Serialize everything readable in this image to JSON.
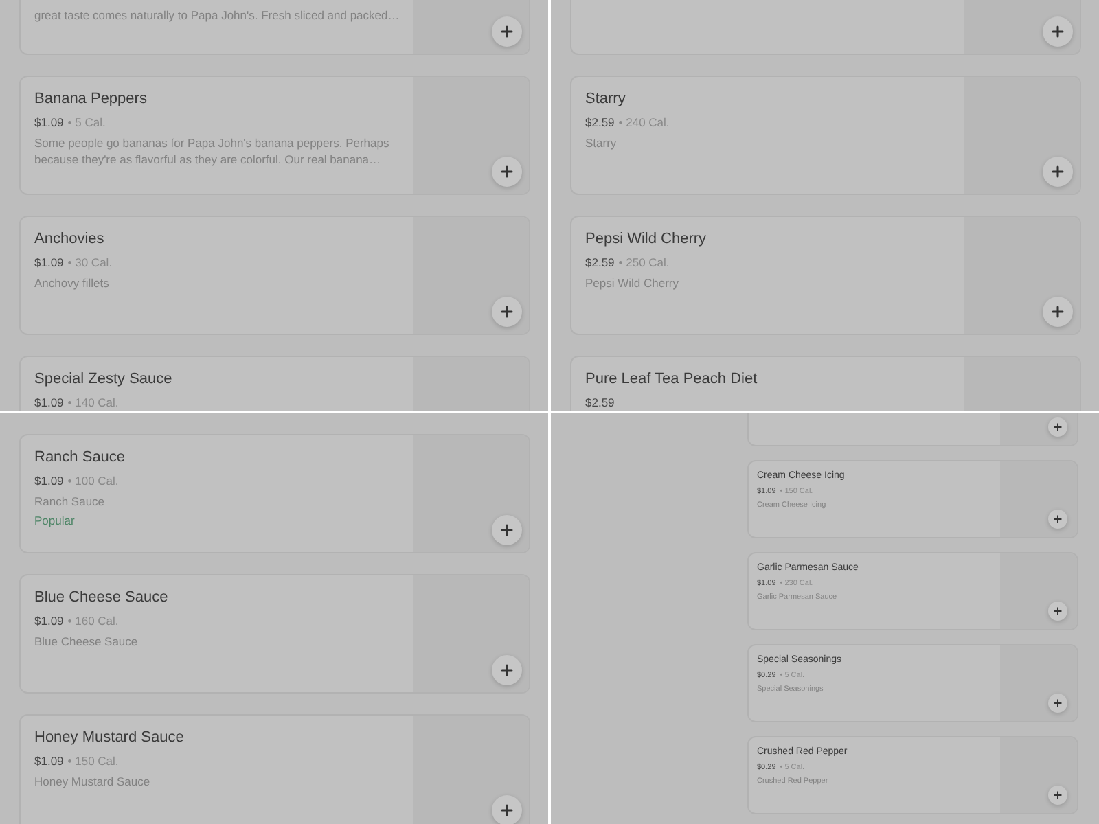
{
  "panels": [
    {
      "kind": "full",
      "items": [
        {
          "kind": "cut",
          "description": "great taste comes naturally to Papa John's. Fresh sliced and packed…"
        },
        {
          "kind": "item",
          "name": "Banana Peppers",
          "price": "$1.09",
          "calories": "• 5 Cal.",
          "description": "Some people go bananas for Papa John's banana peppers. Perhaps because they're as flavorful as they are colorful. Our real banana…"
        },
        {
          "kind": "item",
          "name": "Anchovies",
          "price": "$1.09",
          "calories": "• 30 Cal.",
          "description": "Anchovy fillets"
        },
        {
          "kind": "clipped",
          "name": "Special Zesty Sauce",
          "price": "$1.09",
          "calories": "• 140 Cal."
        }
      ]
    },
    {
      "kind": "full",
      "items": [
        {
          "kind": "cut"
        },
        {
          "kind": "item",
          "name": "Starry",
          "price": "$2.59",
          "calories": "• 240 Cal.",
          "description": "Starry"
        },
        {
          "kind": "item",
          "name": "Pepsi Wild Cherry",
          "price": "$2.59",
          "calories": "• 250 Cal.",
          "description": "Pepsi Wild Cherry"
        },
        {
          "kind": "clipped",
          "name": "Pure Leaf Tea Peach Diet",
          "price": "$2.59"
        }
      ]
    },
    {
      "kind": "full",
      "items": [
        {
          "kind": "item",
          "name": "Ranch Sauce",
          "price": "$1.09",
          "calories": "• 100 Cal.",
          "description": "Ranch Sauce",
          "tag": "Popular"
        },
        {
          "kind": "item",
          "name": "Blue Cheese Sauce",
          "price": "$1.09",
          "calories": "• 160 Cal.",
          "description": "Blue Cheese Sauce"
        },
        {
          "kind": "item",
          "name": "Honey Mustard Sauce",
          "price": "$1.09",
          "calories": "• 150 Cal.",
          "description": "Honey Mustard Sauce"
        }
      ]
    },
    {
      "kind": "compact",
      "items": [
        {
          "kind": "cut"
        },
        {
          "kind": "item",
          "name": "Cream Cheese Icing",
          "price": "$1.09",
          "calories": "• 150 Cal.",
          "description": "Cream Cheese Icing"
        },
        {
          "kind": "item",
          "name": "Garlic Parmesan Sauce",
          "price": "$1.09",
          "calories": "• 230 Cal.",
          "description": "Garlic Parmesan Sauce"
        },
        {
          "kind": "item",
          "name": "Special Seasonings",
          "price": "$0.29",
          "calories": "• 5 Cal.",
          "description": "Special Seasonings"
        },
        {
          "kind": "item",
          "name": "Crushed Red Pepper",
          "price": "$0.29",
          "calories": "• 5 Cal.",
          "description": "Crushed Red Pepper"
        }
      ]
    }
  ]
}
